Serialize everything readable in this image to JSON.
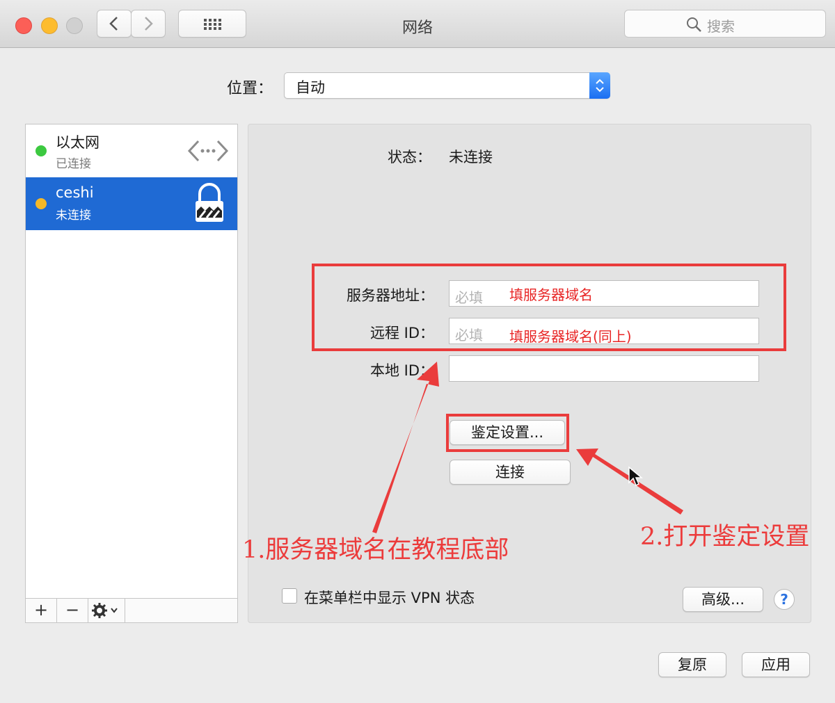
{
  "window": {
    "title": "网络",
    "search_placeholder": "搜索"
  },
  "location": {
    "label": "位置：",
    "value": "自动"
  },
  "services": [
    {
      "name": "以太网",
      "status": "已连接",
      "dot_color": "#3cc940",
      "icon": "ethernet-arrows-icon",
      "selected": false
    },
    {
      "name": "ceshi",
      "status": "未连接",
      "dot_color": "#f5b828",
      "icon": "vpn-lock-icon",
      "selected": true
    }
  ],
  "list_toolbar": {
    "add": "+",
    "remove": "−",
    "gear": "gear-icon"
  },
  "detail": {
    "status_label": "状态：",
    "status_value": "未连接",
    "server_label": "服务器地址：",
    "server_placeholder": "必填",
    "server_hint": "填服务器域名",
    "remote_label": "远程 ID：",
    "remote_placeholder": "必填",
    "remote_hint": "填服务器域名(同上)",
    "local_label": "本地 ID：",
    "auth_button": "鉴定设置...",
    "connect_button": "连接",
    "show_vpn_label": "在菜单栏中显示 VPN 状态",
    "advanced_button": "高级...",
    "help": "?"
  },
  "annotations": {
    "note1": "1.服务器域名在教程底部",
    "note2": "2.打开鉴定设置"
  },
  "footer": {
    "revert_button": "复原",
    "apply_button": "应用"
  },
  "colors": {
    "accent": "#1f6ad4",
    "annotation_red": "#ea3c3c"
  }
}
